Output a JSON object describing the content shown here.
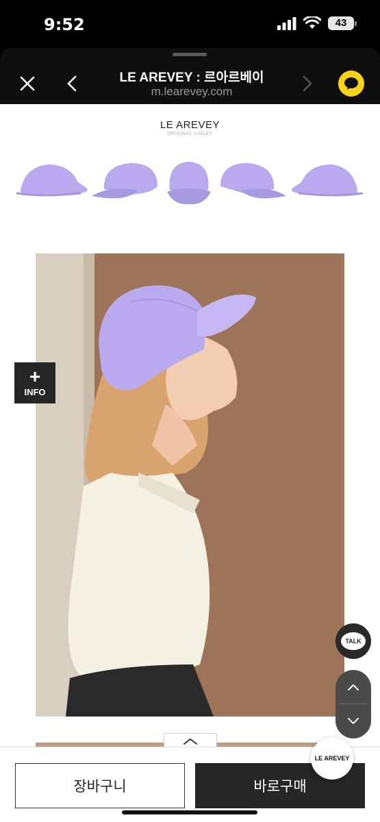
{
  "status_bar": {
    "time": "9:52",
    "battery": "43"
  },
  "header": {
    "title": "LE AREVEY : 르아르베이",
    "url": "m.learevey.com",
    "close_icon": "close-icon",
    "back_icon": "chevron-left-icon",
    "forward_icon": "chevron-right-icon",
    "share_icon": "kakao-chat-icon"
  },
  "product": {
    "brand": "LE AREVEY",
    "subtitle": "ORIGINAL VIOLET",
    "cap_color": "#b9aaf0",
    "photo_alt": "model wearing violet LE AREVEY cap"
  },
  "floating": {
    "info_plus": "+",
    "info_label": "INFO",
    "talk_label": "TALK",
    "scroll_up_icon": "chevron-up-icon",
    "scroll_down_icon": "chevron-down-icon",
    "collapse_icon": "chevron-up-icon"
  },
  "bottom_bar": {
    "cart_label": "장바구니",
    "buy_label": "바로구매",
    "logo_text": "LE AREVEY"
  },
  "colors": {
    "accent_dark": "#262626",
    "kakao_yellow": "#f7d417",
    "violet": "#b9aaf0"
  }
}
